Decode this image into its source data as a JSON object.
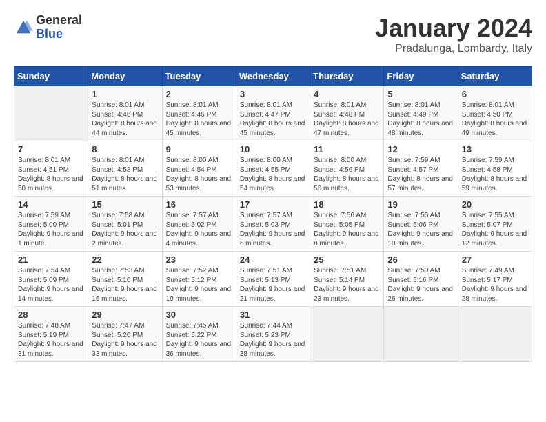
{
  "logo": {
    "general": "General",
    "blue": "Blue"
  },
  "header": {
    "month_year": "January 2024",
    "location": "Pradalunga, Lombardy, Italy"
  },
  "days_of_week": [
    "Sunday",
    "Monday",
    "Tuesday",
    "Wednesday",
    "Thursday",
    "Friday",
    "Saturday"
  ],
  "weeks": [
    [
      {
        "day": "",
        "sunrise": "",
        "sunset": "",
        "daylight": ""
      },
      {
        "day": "1",
        "sunrise": "Sunrise: 8:01 AM",
        "sunset": "Sunset: 4:46 PM",
        "daylight": "Daylight: 8 hours and 44 minutes."
      },
      {
        "day": "2",
        "sunrise": "Sunrise: 8:01 AM",
        "sunset": "Sunset: 4:46 PM",
        "daylight": "Daylight: 8 hours and 45 minutes."
      },
      {
        "day": "3",
        "sunrise": "Sunrise: 8:01 AM",
        "sunset": "Sunset: 4:47 PM",
        "daylight": "Daylight: 8 hours and 45 minutes."
      },
      {
        "day": "4",
        "sunrise": "Sunrise: 8:01 AM",
        "sunset": "Sunset: 4:48 PM",
        "daylight": "Daylight: 8 hours and 47 minutes."
      },
      {
        "day": "5",
        "sunrise": "Sunrise: 8:01 AM",
        "sunset": "Sunset: 4:49 PM",
        "daylight": "Daylight: 8 hours and 48 minutes."
      },
      {
        "day": "6",
        "sunrise": "Sunrise: 8:01 AM",
        "sunset": "Sunset: 4:50 PM",
        "daylight": "Daylight: 8 hours and 49 minutes."
      }
    ],
    [
      {
        "day": "7",
        "sunrise": "Sunrise: 8:01 AM",
        "sunset": "Sunset: 4:51 PM",
        "daylight": "Daylight: 8 hours and 50 minutes."
      },
      {
        "day": "8",
        "sunrise": "Sunrise: 8:01 AM",
        "sunset": "Sunset: 4:53 PM",
        "daylight": "Daylight: 8 hours and 51 minutes."
      },
      {
        "day": "9",
        "sunrise": "Sunrise: 8:00 AM",
        "sunset": "Sunset: 4:54 PM",
        "daylight": "Daylight: 8 hours and 53 minutes."
      },
      {
        "day": "10",
        "sunrise": "Sunrise: 8:00 AM",
        "sunset": "Sunset: 4:55 PM",
        "daylight": "Daylight: 8 hours and 54 minutes."
      },
      {
        "day": "11",
        "sunrise": "Sunrise: 8:00 AM",
        "sunset": "Sunset: 4:56 PM",
        "daylight": "Daylight: 8 hours and 56 minutes."
      },
      {
        "day": "12",
        "sunrise": "Sunrise: 7:59 AM",
        "sunset": "Sunset: 4:57 PM",
        "daylight": "Daylight: 8 hours and 57 minutes."
      },
      {
        "day": "13",
        "sunrise": "Sunrise: 7:59 AM",
        "sunset": "Sunset: 4:58 PM",
        "daylight": "Daylight: 8 hours and 59 minutes."
      }
    ],
    [
      {
        "day": "14",
        "sunrise": "Sunrise: 7:59 AM",
        "sunset": "Sunset: 5:00 PM",
        "daylight": "Daylight: 9 hours and 1 minute."
      },
      {
        "day": "15",
        "sunrise": "Sunrise: 7:58 AM",
        "sunset": "Sunset: 5:01 PM",
        "daylight": "Daylight: 9 hours and 2 minutes."
      },
      {
        "day": "16",
        "sunrise": "Sunrise: 7:57 AM",
        "sunset": "Sunset: 5:02 PM",
        "daylight": "Daylight: 9 hours and 4 minutes."
      },
      {
        "day": "17",
        "sunrise": "Sunrise: 7:57 AM",
        "sunset": "Sunset: 5:03 PM",
        "daylight": "Daylight: 9 hours and 6 minutes."
      },
      {
        "day": "18",
        "sunrise": "Sunrise: 7:56 AM",
        "sunset": "Sunset: 5:05 PM",
        "daylight": "Daylight: 9 hours and 8 minutes."
      },
      {
        "day": "19",
        "sunrise": "Sunrise: 7:55 AM",
        "sunset": "Sunset: 5:06 PM",
        "daylight": "Daylight: 9 hours and 10 minutes."
      },
      {
        "day": "20",
        "sunrise": "Sunrise: 7:55 AM",
        "sunset": "Sunset: 5:07 PM",
        "daylight": "Daylight: 9 hours and 12 minutes."
      }
    ],
    [
      {
        "day": "21",
        "sunrise": "Sunrise: 7:54 AM",
        "sunset": "Sunset: 5:09 PM",
        "daylight": "Daylight: 9 hours and 14 minutes."
      },
      {
        "day": "22",
        "sunrise": "Sunrise: 7:53 AM",
        "sunset": "Sunset: 5:10 PM",
        "daylight": "Daylight: 9 hours and 16 minutes."
      },
      {
        "day": "23",
        "sunrise": "Sunrise: 7:52 AM",
        "sunset": "Sunset: 5:12 PM",
        "daylight": "Daylight: 9 hours and 19 minutes."
      },
      {
        "day": "24",
        "sunrise": "Sunrise: 7:51 AM",
        "sunset": "Sunset: 5:13 PM",
        "daylight": "Daylight: 9 hours and 21 minutes."
      },
      {
        "day": "25",
        "sunrise": "Sunrise: 7:51 AM",
        "sunset": "Sunset: 5:14 PM",
        "daylight": "Daylight: 9 hours and 23 minutes."
      },
      {
        "day": "26",
        "sunrise": "Sunrise: 7:50 AM",
        "sunset": "Sunset: 5:16 PM",
        "daylight": "Daylight: 9 hours and 26 minutes."
      },
      {
        "day": "27",
        "sunrise": "Sunrise: 7:49 AM",
        "sunset": "Sunset: 5:17 PM",
        "daylight": "Daylight: 9 hours and 28 minutes."
      }
    ],
    [
      {
        "day": "28",
        "sunrise": "Sunrise: 7:48 AM",
        "sunset": "Sunset: 5:19 PM",
        "daylight": "Daylight: 9 hours and 31 minutes."
      },
      {
        "day": "29",
        "sunrise": "Sunrise: 7:47 AM",
        "sunset": "Sunset: 5:20 PM",
        "daylight": "Daylight: 9 hours and 33 minutes."
      },
      {
        "day": "30",
        "sunrise": "Sunrise: 7:45 AM",
        "sunset": "Sunset: 5:22 PM",
        "daylight": "Daylight: 9 hours and 36 minutes."
      },
      {
        "day": "31",
        "sunrise": "Sunrise: 7:44 AM",
        "sunset": "Sunset: 5:23 PM",
        "daylight": "Daylight: 9 hours and 38 minutes."
      },
      {
        "day": "",
        "sunrise": "",
        "sunset": "",
        "daylight": ""
      },
      {
        "day": "",
        "sunrise": "",
        "sunset": "",
        "daylight": ""
      },
      {
        "day": "",
        "sunrise": "",
        "sunset": "",
        "daylight": ""
      }
    ]
  ]
}
